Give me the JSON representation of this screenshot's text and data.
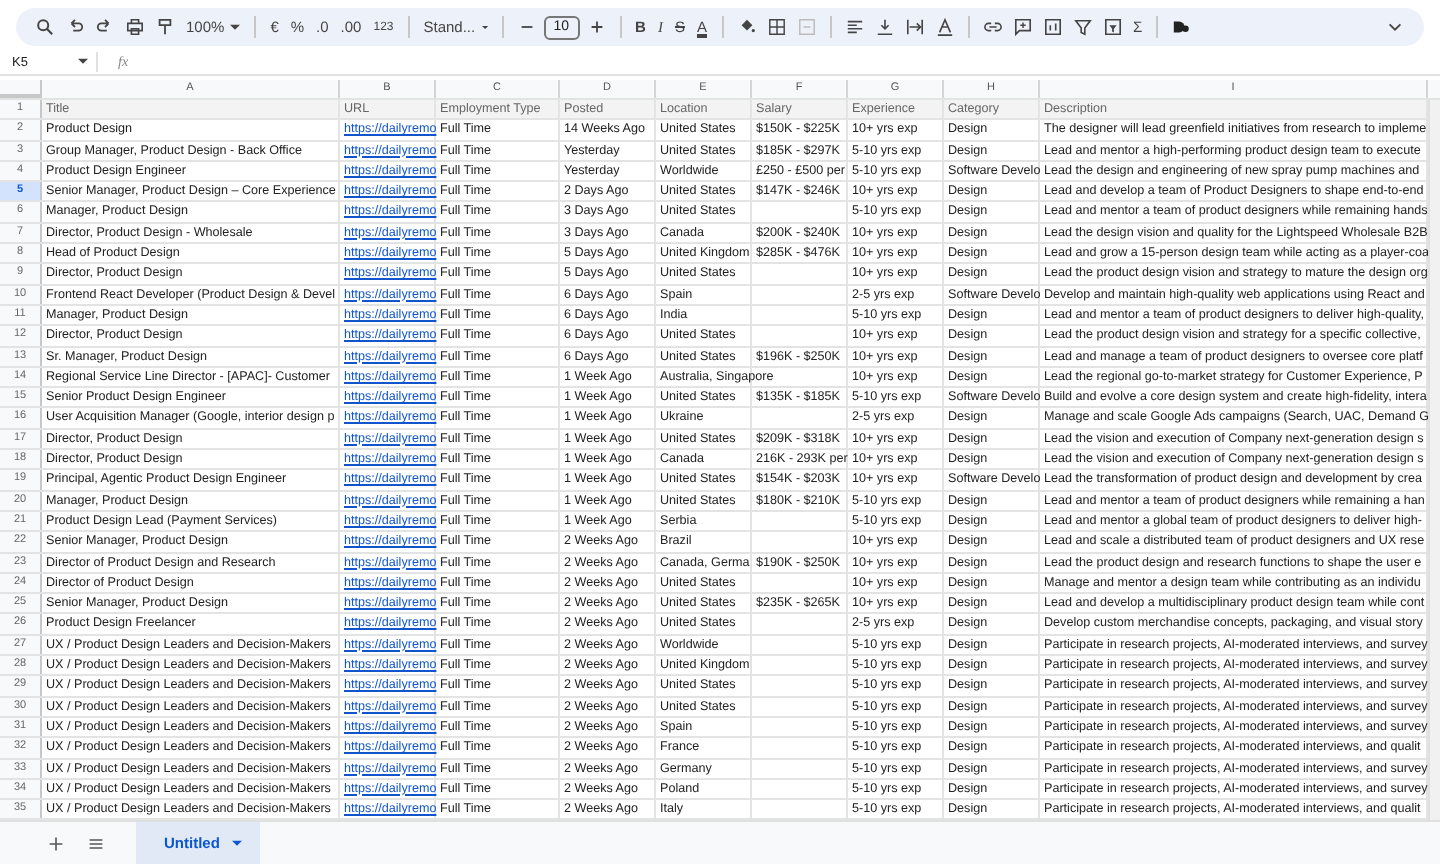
{
  "toolbar": {
    "zoom": "100%",
    "currency": "€",
    "percent": "%",
    "decrease_decimals": ".0",
    "increase_decimals": ".00",
    "number_format": "123",
    "format": "Stand...",
    "font_size": "10",
    "bold": "B",
    "italic": "I",
    "strikethrough": "S",
    "text_color": "A",
    "functions": "Σ"
  },
  "name_box": "K5",
  "formula_label": "fx",
  "columns": [
    {
      "letter": "A",
      "kind": "text"
    },
    {
      "letter": "B",
      "kind": "link"
    },
    {
      "letter": "C",
      "kind": "text"
    },
    {
      "letter": "D",
      "kind": "text"
    },
    {
      "letter": "E",
      "kind": "text"
    },
    {
      "letter": "F",
      "kind": "text"
    },
    {
      "letter": "G",
      "kind": "text"
    },
    {
      "letter": "H",
      "kind": "text"
    },
    {
      "letter": "I",
      "kind": "text"
    }
  ],
  "rows": [
    {
      "number": "1",
      "kind": "header",
      "selected": false,
      "cells": [
        "Title",
        "URL",
        "Employment Type",
        "Posted",
        "Location",
        "Salary",
        "Experience",
        "Category",
        "Description"
      ]
    },
    {
      "number": "2",
      "kind": "data",
      "selected": false,
      "cells": [
        "Product Design",
        "https://dailyremo",
        "Full Time",
        "14 Weeks Ago",
        "United States",
        "$150K - $225K",
        "10+ yrs exp",
        "Design",
        "The designer will lead greenfield initiatives from research to impleme"
      ]
    },
    {
      "number": "3",
      "kind": "data",
      "selected": false,
      "cells": [
        "Group Manager, Product Design - Back Office",
        "https://dailyremo",
        "Full Time",
        "Yesterday",
        "United States",
        "$185K - $297K",
        "5-10 yrs exp",
        "Design",
        "Lead and mentor a high-performing product design team to execute"
      ]
    },
    {
      "number": "4",
      "kind": "data",
      "selected": false,
      "cells": [
        "Product Design Engineer",
        "https://dailyremo",
        "Full Time",
        "Yesterday",
        "Worldwide",
        "£250 - £500 per",
        "5-10 yrs exp",
        "Software Develo",
        "Lead the design and engineering of new spray pump machines and"
      ]
    },
    {
      "number": "5",
      "kind": "data",
      "selected": true,
      "cells": [
        "Senior Manager, Product Design – Core Experience",
        "https://dailyremo",
        "Full Time",
        "2 Days Ago",
        "United States",
        "$147K - $246K",
        "10+ yrs exp",
        "Design",
        "Lead and develop a team of Product Designers to shape end-to-end"
      ]
    },
    {
      "number": "6",
      "kind": "data",
      "selected": false,
      "cells": [
        "Manager, Product Design",
        "https://dailyremo",
        "Full Time",
        "3 Days Ago",
        "United States",
        null,
        "5-10 yrs exp",
        "Design",
        "Lead and mentor a team of product designers while remaining hands"
      ]
    },
    {
      "number": "7",
      "kind": "data",
      "selected": false,
      "cells": [
        "Director, Product Design - Wholesale",
        "https://dailyremo",
        "Full Time",
        "3 Days Ago",
        "Canada",
        "$200K - $240K",
        "10+ yrs exp",
        "Design",
        "Lead the design vision and quality for the Lightspeed Wholesale B2B"
      ]
    },
    {
      "number": "8",
      "kind": "data",
      "selected": false,
      "cells": [
        "Head of Product Design",
        "https://dailyremo",
        "Full Time",
        "5 Days Ago",
        "United Kingdom",
        "$285K - $476K",
        "10+ yrs exp",
        "Design",
        "Lead and grow a 15-person design team while acting as a player-coa"
      ]
    },
    {
      "number": "9",
      "kind": "data",
      "selected": false,
      "cells": [
        "Director, Product Design",
        "https://dailyremo",
        "Full Time",
        "5 Days Ago",
        "United States",
        null,
        "10+ yrs exp",
        "Design",
        "Lead the product design vision and strategy to mature the design org"
      ]
    },
    {
      "number": "10",
      "kind": "data",
      "selected": false,
      "cells": [
        "Frontend React Developer (Product Design & Devel",
        "https://dailyremo",
        "Full Time",
        "6 Days Ago",
        "Spain",
        null,
        "2-5 yrs exp",
        "Software Develo",
        "Develop and maintain high-quality web applications using React and"
      ]
    },
    {
      "number": "11",
      "kind": "data",
      "selected": false,
      "cells": [
        "Manager, Product Design",
        "https://dailyremo",
        "Full Time",
        "6 Days Ago",
        "India",
        null,
        "5-10 yrs exp",
        "Design",
        "Lead and mentor a team of product designers to deliver high-quality,"
      ]
    },
    {
      "number": "12",
      "kind": "data",
      "selected": false,
      "cells": [
        "Director, Product Design",
        "https://dailyremo",
        "Full Time",
        "6 Days Ago",
        "United States",
        null,
        "10+ yrs exp",
        "Design",
        "Lead the product design vision and strategy for a specific collective,"
      ]
    },
    {
      "number": "13",
      "kind": "data",
      "selected": false,
      "cells": [
        "Sr. Manager, Product Design",
        "https://dailyremo",
        "Full Time",
        "6 Days Ago",
        "United States",
        "$196K - $250K",
        "10+ yrs exp",
        "Design",
        "Lead and manage a team of product designers to oversee core platf"
      ]
    },
    {
      "number": "14",
      "kind": "data",
      "selected": false,
      "cells": [
        "Regional Service Line Director - [APAC]- Customer",
        "https://dailyremo",
        "Full Time",
        "1 Week Ago",
        "Australia, Singapore",
        null,
        "10+ yrs exp",
        "Design",
        "Lead the regional go-to-market strategy for Customer Experience, P"
      ]
    },
    {
      "number": "15",
      "kind": "data",
      "selected": false,
      "cells": [
        "Senior Product Design Engineer",
        "https://dailyremo",
        "Full Time",
        "1 Week Ago",
        "United States",
        "$135K - $185K",
        "5-10 yrs exp",
        "Software Develo",
        "Build and evolve a core design system and create high-fidelity, intera"
      ]
    },
    {
      "number": "16",
      "kind": "data",
      "selected": false,
      "cells": [
        "User Acquisition Manager (Google, interior design p",
        "https://dailyremo",
        "Full Time",
        "1 Week Ago",
        "Ukraine",
        null,
        "2-5 yrs exp",
        "Design",
        "Manage and scale Google Ads campaigns (Search, UAC, Demand G"
      ]
    },
    {
      "number": "17",
      "kind": "data",
      "selected": false,
      "cells": [
        "Director, Product Design",
        "https://dailyremo",
        "Full Time",
        "1 Week Ago",
        "United States",
        "$209K - $318K",
        "10+ yrs exp",
        "Design",
        "Lead the vision and execution of Company next-generation design s"
      ]
    },
    {
      "number": "18",
      "kind": "data",
      "selected": false,
      "cells": [
        "Director, Product Design",
        "https://dailyremo",
        "Full Time",
        "1 Week Ago",
        "Canada",
        "216K - 293K per",
        "10+ yrs exp",
        "Design",
        "Lead the vision and execution of Company next-generation design s"
      ]
    },
    {
      "number": "19",
      "kind": "data",
      "selected": false,
      "cells": [
        "Principal, Agentic Product Design Engineer",
        "https://dailyremo",
        "Full Time",
        "1 Week Ago",
        "United States",
        "$154K - $203K",
        "10+ yrs exp",
        "Software Develo",
        "Lead the transformation of product design and development by crea"
      ]
    },
    {
      "number": "20",
      "kind": "data",
      "selected": false,
      "cells": [
        "Manager, Product Design",
        "https://dailyremo",
        "Full Time",
        "1 Week Ago",
        "United States",
        "$180K - $210K",
        "5-10 yrs exp",
        "Design",
        "Lead and mentor a team of product designers while remaining a han"
      ]
    },
    {
      "number": "21",
      "kind": "data",
      "selected": false,
      "cells": [
        "Product Design Lead (Payment Services)",
        "https://dailyremo",
        "Full Time",
        "1 Week Ago",
        "Serbia",
        null,
        "5-10 yrs exp",
        "Design",
        "Lead and mentor a global team of product designers to deliver high-"
      ]
    },
    {
      "number": "22",
      "kind": "data",
      "selected": false,
      "cells": [
        "Senior Manager, Product Design",
        "https://dailyremo",
        "Full Time",
        "2 Weeks Ago",
        "Brazil",
        null,
        "10+ yrs exp",
        "Design",
        "Lead and scale a distributed team of product designers and UX rese"
      ]
    },
    {
      "number": "23",
      "kind": "data",
      "selected": false,
      "cells": [
        "Director of Product Design and Research",
        "https://dailyremo",
        "Full Time",
        "2 Weeks Ago",
        "Canada, Germa",
        "$190K - $250K",
        "10+ yrs exp",
        "Design",
        "Lead the product design and research functions to shape the user e"
      ]
    },
    {
      "number": "24",
      "kind": "data",
      "selected": false,
      "cells": [
        "Director of Product Design",
        "https://dailyremo",
        "Full Time",
        "2 Weeks Ago",
        "United States",
        null,
        "10+ yrs exp",
        "Design",
        "Manage and mentor a design team while contributing as an individu"
      ]
    },
    {
      "number": "25",
      "kind": "data",
      "selected": false,
      "cells": [
        "Senior Manager, Product Design",
        "https://dailyremo",
        "Full Time",
        "2 Weeks Ago",
        "United States",
        "$235K - $265K",
        "10+ yrs exp",
        "Design",
        "Lead and develop a multidisciplinary product design team while cont"
      ]
    },
    {
      "number": "26",
      "kind": "data",
      "selected": false,
      "cells": [
        "Product Design Freelancer",
        "https://dailyremo",
        "Full Time",
        "2 Weeks Ago",
        "United States",
        null,
        "2-5 yrs exp",
        "Design",
        "Develop custom merchandise concepts, packaging, and visual story"
      ]
    },
    {
      "number": "27",
      "kind": "data",
      "selected": false,
      "cells": [
        "UX / Product Design Leaders and Decision-Makers",
        "https://dailyremo",
        "Full Time",
        "2 Weeks Ago",
        "Worldwide",
        null,
        "5-10 yrs exp",
        "Design",
        "Participate in research projects, AI-moderated interviews, and survey"
      ]
    },
    {
      "number": "28",
      "kind": "data",
      "selected": false,
      "cells": [
        "UX / Product Design Leaders and Decision-Makers",
        "https://dailyremo",
        "Full Time",
        "2 Weeks Ago",
        "United Kingdom",
        null,
        "5-10 yrs exp",
        "Design",
        "Participate in research projects, AI-moderated interviews, and survey"
      ]
    },
    {
      "number": "29",
      "kind": "data",
      "selected": false,
      "cells": [
        "UX / Product Design Leaders and Decision-Makers",
        "https://dailyremo",
        "Full Time",
        "2 Weeks Ago",
        "United States",
        null,
        "5-10 yrs exp",
        "Design",
        "Participate in research projects, AI-moderated interviews, and survey"
      ]
    },
    {
      "number": "30",
      "kind": "data",
      "selected": false,
      "cells": [
        "UX / Product Design Leaders and Decision-Makers",
        "https://dailyremo",
        "Full Time",
        "2 Weeks Ago",
        "United States",
        null,
        "5-10 yrs exp",
        "Design",
        "Participate in research projects, AI-moderated interviews, and survey"
      ]
    },
    {
      "number": "31",
      "kind": "data",
      "selected": false,
      "cells": [
        "UX / Product Design Leaders and Decision-Makers",
        "https://dailyremo",
        "Full Time",
        "2 Weeks Ago",
        "Spain",
        null,
        "5-10 yrs exp",
        "Design",
        "Participate in research projects, AI-moderated interviews, and survey"
      ]
    },
    {
      "number": "32",
      "kind": "data",
      "selected": false,
      "cells": [
        "UX / Product Design Leaders and Decision-Makers",
        "https://dailyremo",
        "Full Time",
        "2 Weeks Ago",
        "France",
        null,
        "5-10 yrs exp",
        "Design",
        "Participate in research projects, AI-moderated interviews, and qualit"
      ]
    },
    {
      "number": "33",
      "kind": "data",
      "selected": false,
      "cells": [
        "UX / Product Design Leaders and Decision-Makers",
        "https://dailyremo",
        "Full Time",
        "2 Weeks Ago",
        "Germany",
        null,
        "5-10 yrs exp",
        "Design",
        "Participate in research projects, AI-moderated interviews, and survey"
      ]
    },
    {
      "number": "34",
      "kind": "data",
      "selected": false,
      "cells": [
        "UX / Product Design Leaders and Decision-Makers",
        "https://dailyremo",
        "Full Time",
        "2 Weeks Ago",
        "Poland",
        null,
        "5-10 yrs exp",
        "Design",
        "Participate in research projects, AI-moderated interviews, and survey"
      ]
    },
    {
      "number": "35",
      "kind": "data",
      "selected": false,
      "cells": [
        "UX / Product Design Leaders and Decision-Makers",
        "https://dailyremo",
        "Full Time",
        "2 Weeks Ago",
        "Italy",
        null,
        "5-10 yrs exp",
        "Design",
        "Participate in research projects, AI-moderated interviews, and qualit"
      ]
    }
  ],
  "sheet_tabs": [
    {
      "label": "Untitled",
      "selected": true
    }
  ]
}
